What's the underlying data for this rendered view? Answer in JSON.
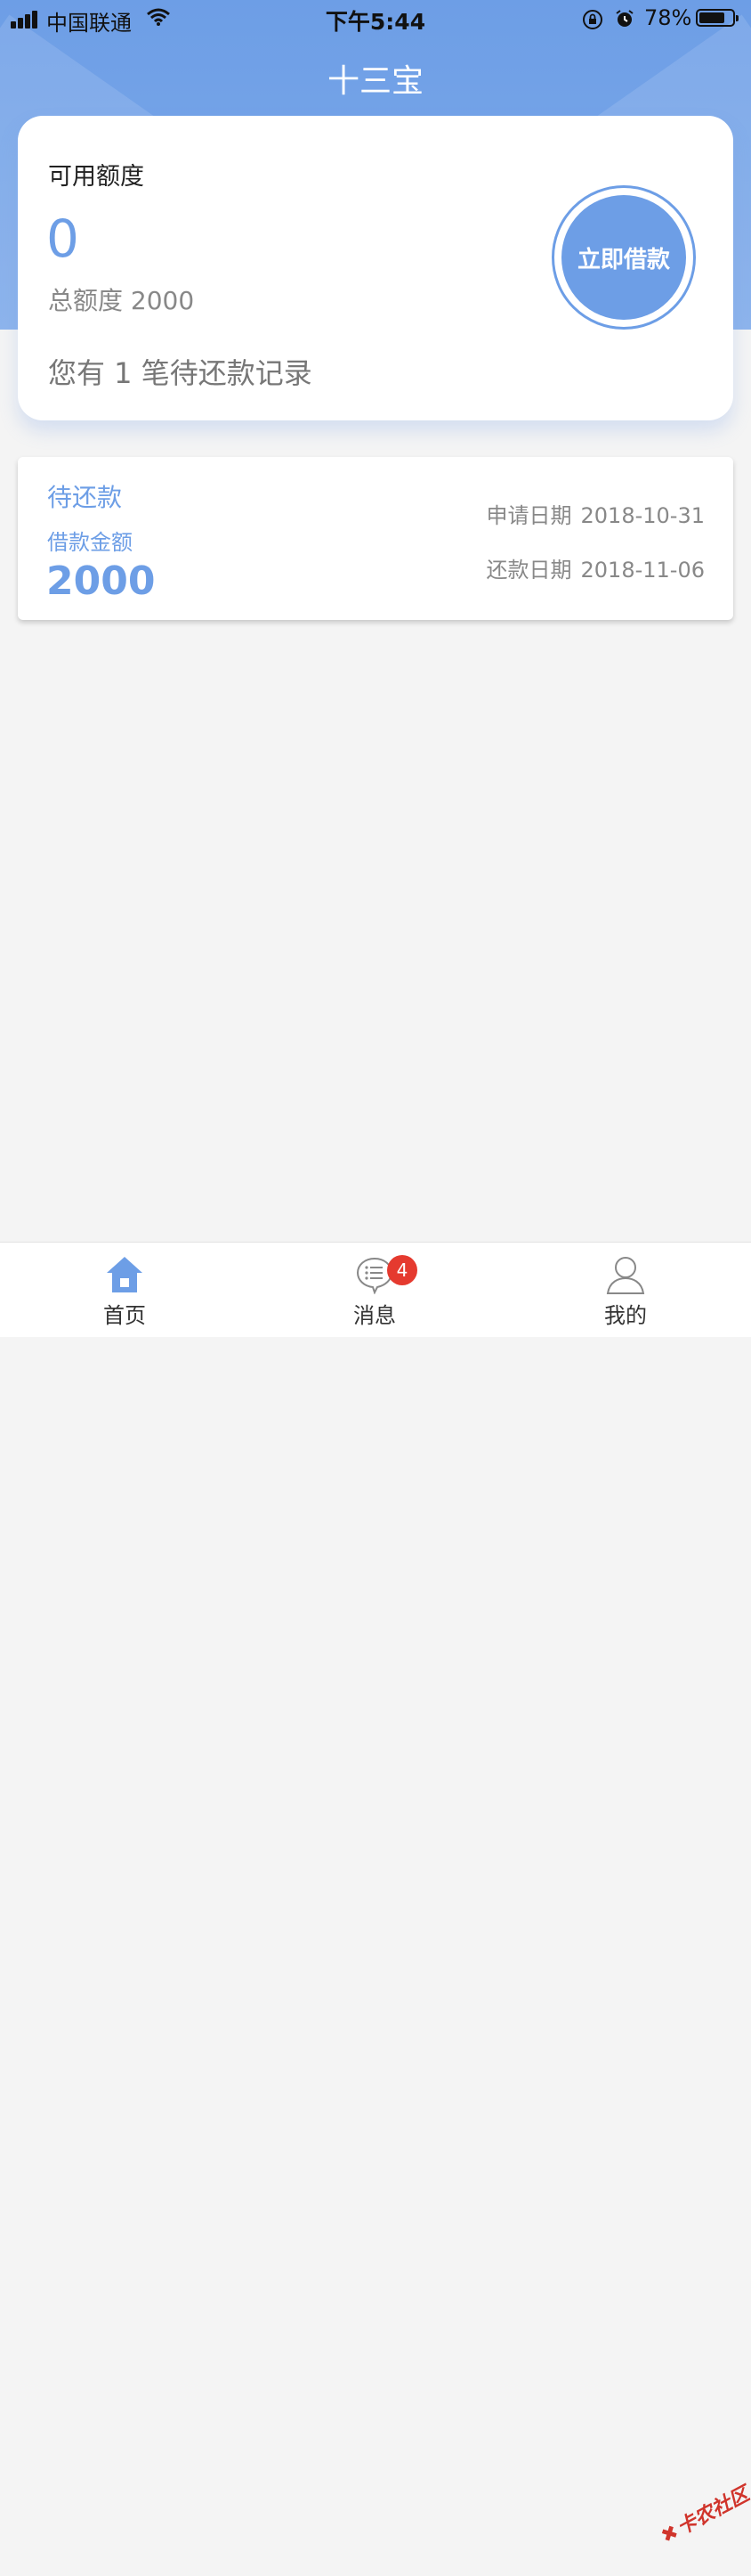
{
  "status_bar": {
    "carrier": "中国联通",
    "time": "下午5:44",
    "battery": "78%",
    "battery_level": 0.78
  },
  "nav": {
    "title": "十三宝"
  },
  "credit": {
    "label": "可用额度",
    "available": "0",
    "total_text": "总额度 2000",
    "pending_text": "您有 1 笔待还款记录",
    "borrow_button": "立即借款"
  },
  "loan": {
    "status": "待还款",
    "amount_label": "借款金额",
    "amount": "2000",
    "apply_label": "申请日期",
    "apply_date": "2018-10-31",
    "repay_label": "还款日期",
    "repay_date": "2018-11-06"
  },
  "tabs": [
    {
      "label": "首页",
      "icon": "home-icon"
    },
    {
      "label": "消息",
      "icon": "message-icon",
      "badge": "4"
    },
    {
      "label": "我的",
      "icon": "user-icon"
    }
  ],
  "watermark": "卡农社区",
  "colors": {
    "accent": "#6d9ee6",
    "badge": "#e53a2f"
  }
}
